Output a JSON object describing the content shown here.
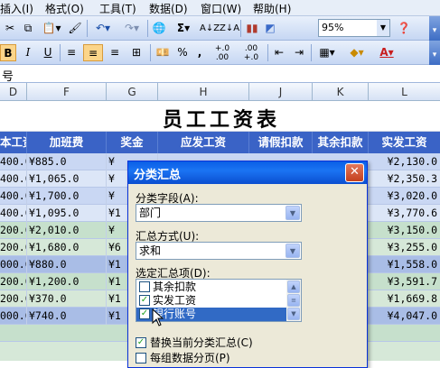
{
  "menu": {
    "items": [
      "插入(I)",
      "格式(O)",
      "工具(T)",
      "数据(D)",
      "窗口(W)",
      "帮助(H)"
    ]
  },
  "toolbar1": {
    "zoom": "95%",
    "buttons": [
      "cut-icon",
      "copy-icon",
      "paste-icon",
      "format-painter-icon",
      "undo-icon",
      "redo-icon",
      "hyperlink-icon",
      "autosum-icon",
      "sort-asc-icon",
      "sort-desc-icon",
      "chart-wizard-icon",
      "drawing-icon",
      "help-icon"
    ]
  },
  "toolbar2": {
    "bold": "B",
    "italic": "I",
    "underline": "U",
    "percent": "%",
    "comma": ",",
    "inc_decimal": "+.0 .00",
    "dec_decimal": ".00 +.0",
    "font_color_letter": "A"
  },
  "formula_bar": {
    "text": "号"
  },
  "columns": [
    "D",
    "F",
    "G",
    "H",
    "J",
    "K",
    "L"
  ],
  "sheet": {
    "title": "员工工资表",
    "headers": [
      "本工资",
      "加班费",
      "奖金",
      "应发工资",
      "请假扣款",
      "其余扣款",
      "实发工资"
    ],
    "rows": [
      {
        "d": "400.0",
        "f": "¥885.0",
        "g": "¥",
        "l": "¥2,130.0"
      },
      {
        "d": "400.0",
        "f": "¥1,065.0",
        "g": "¥",
        "l": "¥2,350.3"
      },
      {
        "d": "400.0",
        "f": "¥1,700.0",
        "g": "¥",
        "l": "¥3,020.0"
      },
      {
        "d": "400.0",
        "f": "¥1,095.0",
        "g": "¥1",
        "l": "¥3,770.6"
      },
      {
        "d": "200.0",
        "f": "¥2,010.0",
        "g": "¥",
        "l": "¥3,150.0"
      },
      {
        "d": "200.0",
        "f": "¥1,680.0",
        "g": "¥6",
        "l": "¥3,255.0"
      },
      {
        "d": "000.0",
        "f": "¥880.0",
        "g": "¥1",
        "l": "¥1,558.0"
      },
      {
        "d": "200.0",
        "f": "¥1,200.0",
        "g": "¥1",
        "l": "¥3,591.7"
      },
      {
        "d": "200.0",
        "f": "¥370.0",
        "g": "¥1",
        "l": "¥1,669.8"
      },
      {
        "d": "000.0",
        "f": "¥740.0",
        "g": "¥1",
        "l": "¥4,047.0"
      }
    ]
  },
  "colors": {
    "header_blue": "#3a63c6",
    "row_light": "#c9d7f3",
    "row_lighter": "#dce6f7",
    "row_green": "#c6e0cc",
    "row_steel": "#a9bde6"
  },
  "dialog": {
    "title": "分类汇总",
    "close": "✕",
    "group_field_label": "分类字段(A):",
    "group_field_value": "部门",
    "summary_label": "汇总方式(U):",
    "summary_value": "求和",
    "items_label": "选定汇总项(D):",
    "items": [
      {
        "label": "其余扣款",
        "checked": false
      },
      {
        "label": "实发工资",
        "checked": true
      },
      {
        "label": "银行账号",
        "checked": true
      }
    ],
    "replace_label": "替换当前分类汇总(C)",
    "replace_checked": true,
    "pagebreak_label": "每组数据分页(P)",
    "pagebreak_checked": false
  }
}
